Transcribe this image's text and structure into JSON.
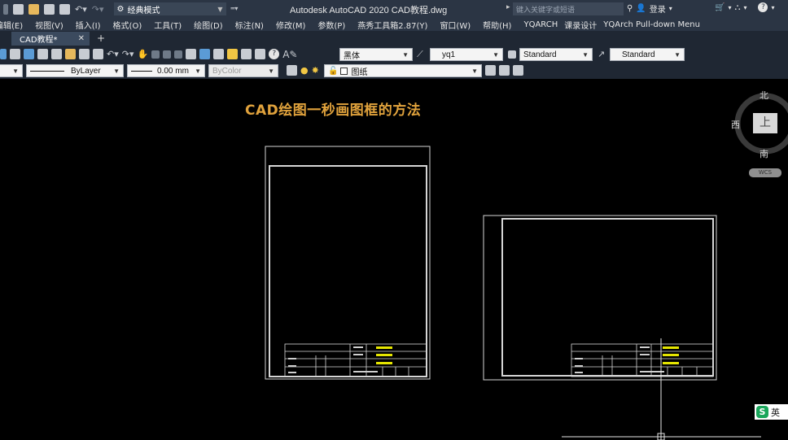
{
  "app": {
    "title": "Autodesk AutoCAD 2020    CAD教程.dwg",
    "workspace": "经典模式",
    "search_placeholder": "键入关键字或短语",
    "login": "登录"
  },
  "menu": {
    "items": [
      "编辑(E)",
      "视图(V)",
      "插入(I)",
      "格式(O)",
      "工具(T)",
      "绘图(D)",
      "标注(N)",
      "修改(M)",
      "参数(P)",
      "燕秀工具箱2.87(Y)",
      "窗口(W)",
      "帮助(H)",
      "YQARCH",
      "课录设计",
      "YQArch Pull-down Menu"
    ]
  },
  "tabs": {
    "active": "CAD教程*",
    "close": "✕",
    "new": "+"
  },
  "toolbar1": {
    "text_font": "黑体",
    "text_style": "yq1",
    "dim_style": "Standard",
    "table_style": "Standard"
  },
  "toolbar2": {
    "linetype": "ByLayer",
    "lineweight": "0.00 mm",
    "color": "ByColor",
    "layer": "图纸"
  },
  "drawing": {
    "title": "CAD绘图一秒画图框的方法"
  },
  "viewcube": {
    "north": "北",
    "south": "南",
    "west": "西",
    "top": "上",
    "wcs": "WCS"
  },
  "ime": {
    "logo": "S",
    "label": "英"
  },
  "colors": {
    "title_accent": "#e0a23c",
    "titleblock_yellow": "#e6e600",
    "canvas": "#000000",
    "chrome": "#2b3544"
  }
}
